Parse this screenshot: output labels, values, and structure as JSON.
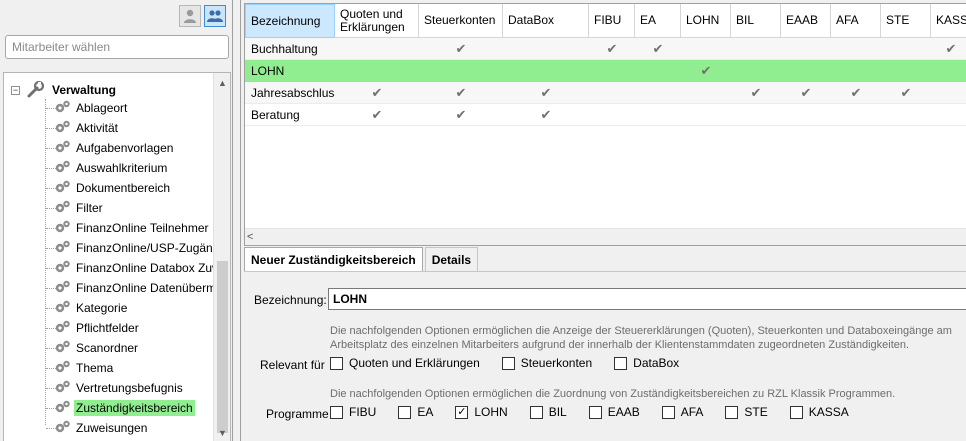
{
  "left": {
    "search_placeholder": "Mitarbeiter wählen",
    "tree": {
      "root": "Verwaltung",
      "children": [
        "Ablageort",
        "Aktivität",
        "Aufgabenvorlagen",
        "Auswahlkriterium",
        "Dokumentbereich",
        "Filter",
        "FinanzOnline Teilnehmer",
        "FinanzOnline/USP-Zugänge",
        "FinanzOnline Databox Zuwe",
        "FinanzOnline Datenübermitt",
        "Kategorie",
        "Pflichtfelder",
        "Scanordner",
        "Thema",
        "Vertretungsbefugnis",
        "Zuständigkeitsbereich",
        "Zuweisungen"
      ],
      "selected_index": 15
    }
  },
  "grid": {
    "columns": [
      "Bezeichnung",
      "Quoten und Erklärungen",
      "Steuerkonten",
      "DataBox",
      "FIBU",
      "EA",
      "LOHN",
      "BIL",
      "EAAB",
      "AFA",
      "STE",
      "KASSA"
    ],
    "rows": [
      {
        "name": "Buchhaltung",
        "checks": [
          false,
          true,
          false,
          true,
          true,
          false,
          false,
          false,
          false,
          false,
          true
        ]
      },
      {
        "name": "LOHN",
        "checks": [
          false,
          false,
          false,
          false,
          false,
          true,
          false,
          false,
          false,
          false,
          false
        ]
      },
      {
        "name": "Jahresabschluss",
        "checks": [
          true,
          true,
          true,
          false,
          false,
          false,
          true,
          true,
          true,
          true,
          false
        ]
      },
      {
        "name": "Beratung",
        "checks": [
          true,
          true,
          true,
          false,
          false,
          false,
          false,
          false,
          false,
          false,
          false
        ]
      }
    ],
    "highlight_row": 1,
    "scroll_left_glyph": "<"
  },
  "tabs": [
    "Neuer Zuständigkeitsbereich",
    "Details"
  ],
  "details": {
    "bez_label": "Bezeichnung:",
    "bez_value": "LOHN",
    "info1_line1": "Die nachfolgenden Optionen ermöglichen die Anzeige der Steuererklärungen (Quoten), Steuerkonten und Databoxeingänge am",
    "info1_line2": "Arbeitsplatz des einzelnen Mitarbeiters aufgrund der innerhalb der Klientenstammdaten zugeordneten Zuständigkeiten.",
    "relevant_label": "Relevant für",
    "relevant_options": [
      {
        "label": "Quoten und Erklärungen",
        "checked": false
      },
      {
        "label": "Steuerkonten",
        "checked": false
      },
      {
        "label": "DataBox",
        "checked": false
      }
    ],
    "info2": "Die nachfolgenden Optionen ermöglichen die Zuordnung von Zuständigkeitsbereichen zu RZL Klassik Programmen.",
    "programme_label": "Programme",
    "programme_options": [
      {
        "label": "FIBU",
        "checked": false
      },
      {
        "label": "EA",
        "checked": false
      },
      {
        "label": "LOHN",
        "checked": true
      },
      {
        "label": "BIL",
        "checked": false
      },
      {
        "label": "EAAB",
        "checked": false
      },
      {
        "label": "AFA",
        "checked": false
      },
      {
        "label": "STE",
        "checked": false
      },
      {
        "label": "KASSA",
        "checked": false
      }
    ]
  },
  "colors": {
    "highlight": "#90ee90",
    "header_active": "#cce8ff",
    "check": "#707070"
  }
}
